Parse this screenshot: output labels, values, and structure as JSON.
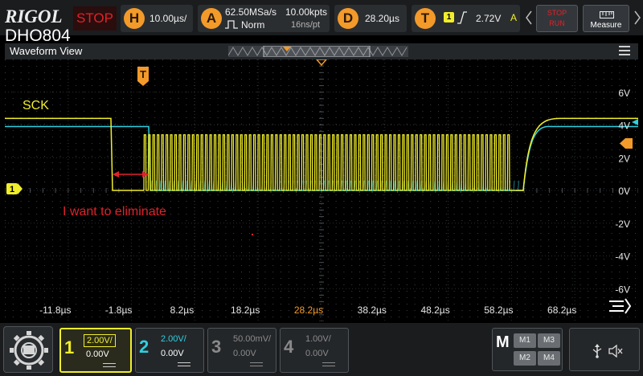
{
  "brand": "RIGOL",
  "model": "DHO804",
  "run_status": "STOP",
  "horizontal": {
    "badge": "H",
    "timebase": "10.00µs/"
  },
  "acquire": {
    "badge": "A",
    "sample_rate": "62.50MSa/s",
    "mode": "Norm",
    "points": "10.00kpts",
    "interval": "16ns/pt"
  },
  "delay": {
    "badge": "D",
    "value": "28.20µs"
  },
  "trigger": {
    "badge": "T",
    "source": "1",
    "level": "2.72V",
    "coupling": "A"
  },
  "controls": {
    "stop_run_line1": "STOP",
    "stop_run_line2": "RUN",
    "measure": "Measure"
  },
  "waveform_view": {
    "title": "Waveform View"
  },
  "annotations": {
    "signal_label": "SCK",
    "note": "I want to eliminate"
  },
  "trigger_marker": "T",
  "ch1_marker": "1",
  "y_axis_labels": [
    "6V",
    "4V",
    "2V",
    "0V",
    "-2V",
    "-4V",
    "-6V"
  ],
  "x_axis_labels": [
    "-11.8µs",
    "-1.8µs",
    "8.2µs",
    "18.2µs",
    "28.2µs",
    "38.2µs",
    "48.2µs",
    "58.2µs",
    "68.2µs"
  ],
  "channels": [
    {
      "num": "1",
      "scale": "2.00V/",
      "offset": "0.00V",
      "color": "#f1ee2b",
      "active": true
    },
    {
      "num": "2",
      "scale": "2.00V/",
      "offset": "0.00V",
      "color": "#2fd0e0",
      "active": false
    },
    {
      "num": "3",
      "scale": "50.00mV/",
      "offset": "0.00V",
      "color": "#8a8a8a",
      "active": false
    },
    {
      "num": "4",
      "scale": "1.00V/",
      "offset": "0.00V",
      "color": "#8a8a8a",
      "active": false
    }
  ],
  "math": {
    "label": "M",
    "buttons": [
      "M1",
      "M3",
      "M2",
      "M4"
    ]
  },
  "colors": {
    "ch1": "#f1ee2b",
    "ch2": "#2fd0e0",
    "accent": "#f39a2a",
    "note": "#e0222a"
  },
  "icons": [
    "settings-gear-icon",
    "usb-icon",
    "speaker-muted-icon",
    "wave-menu-icon",
    "rising-edge-icon",
    "hamburger-menu-icon"
  ]
}
